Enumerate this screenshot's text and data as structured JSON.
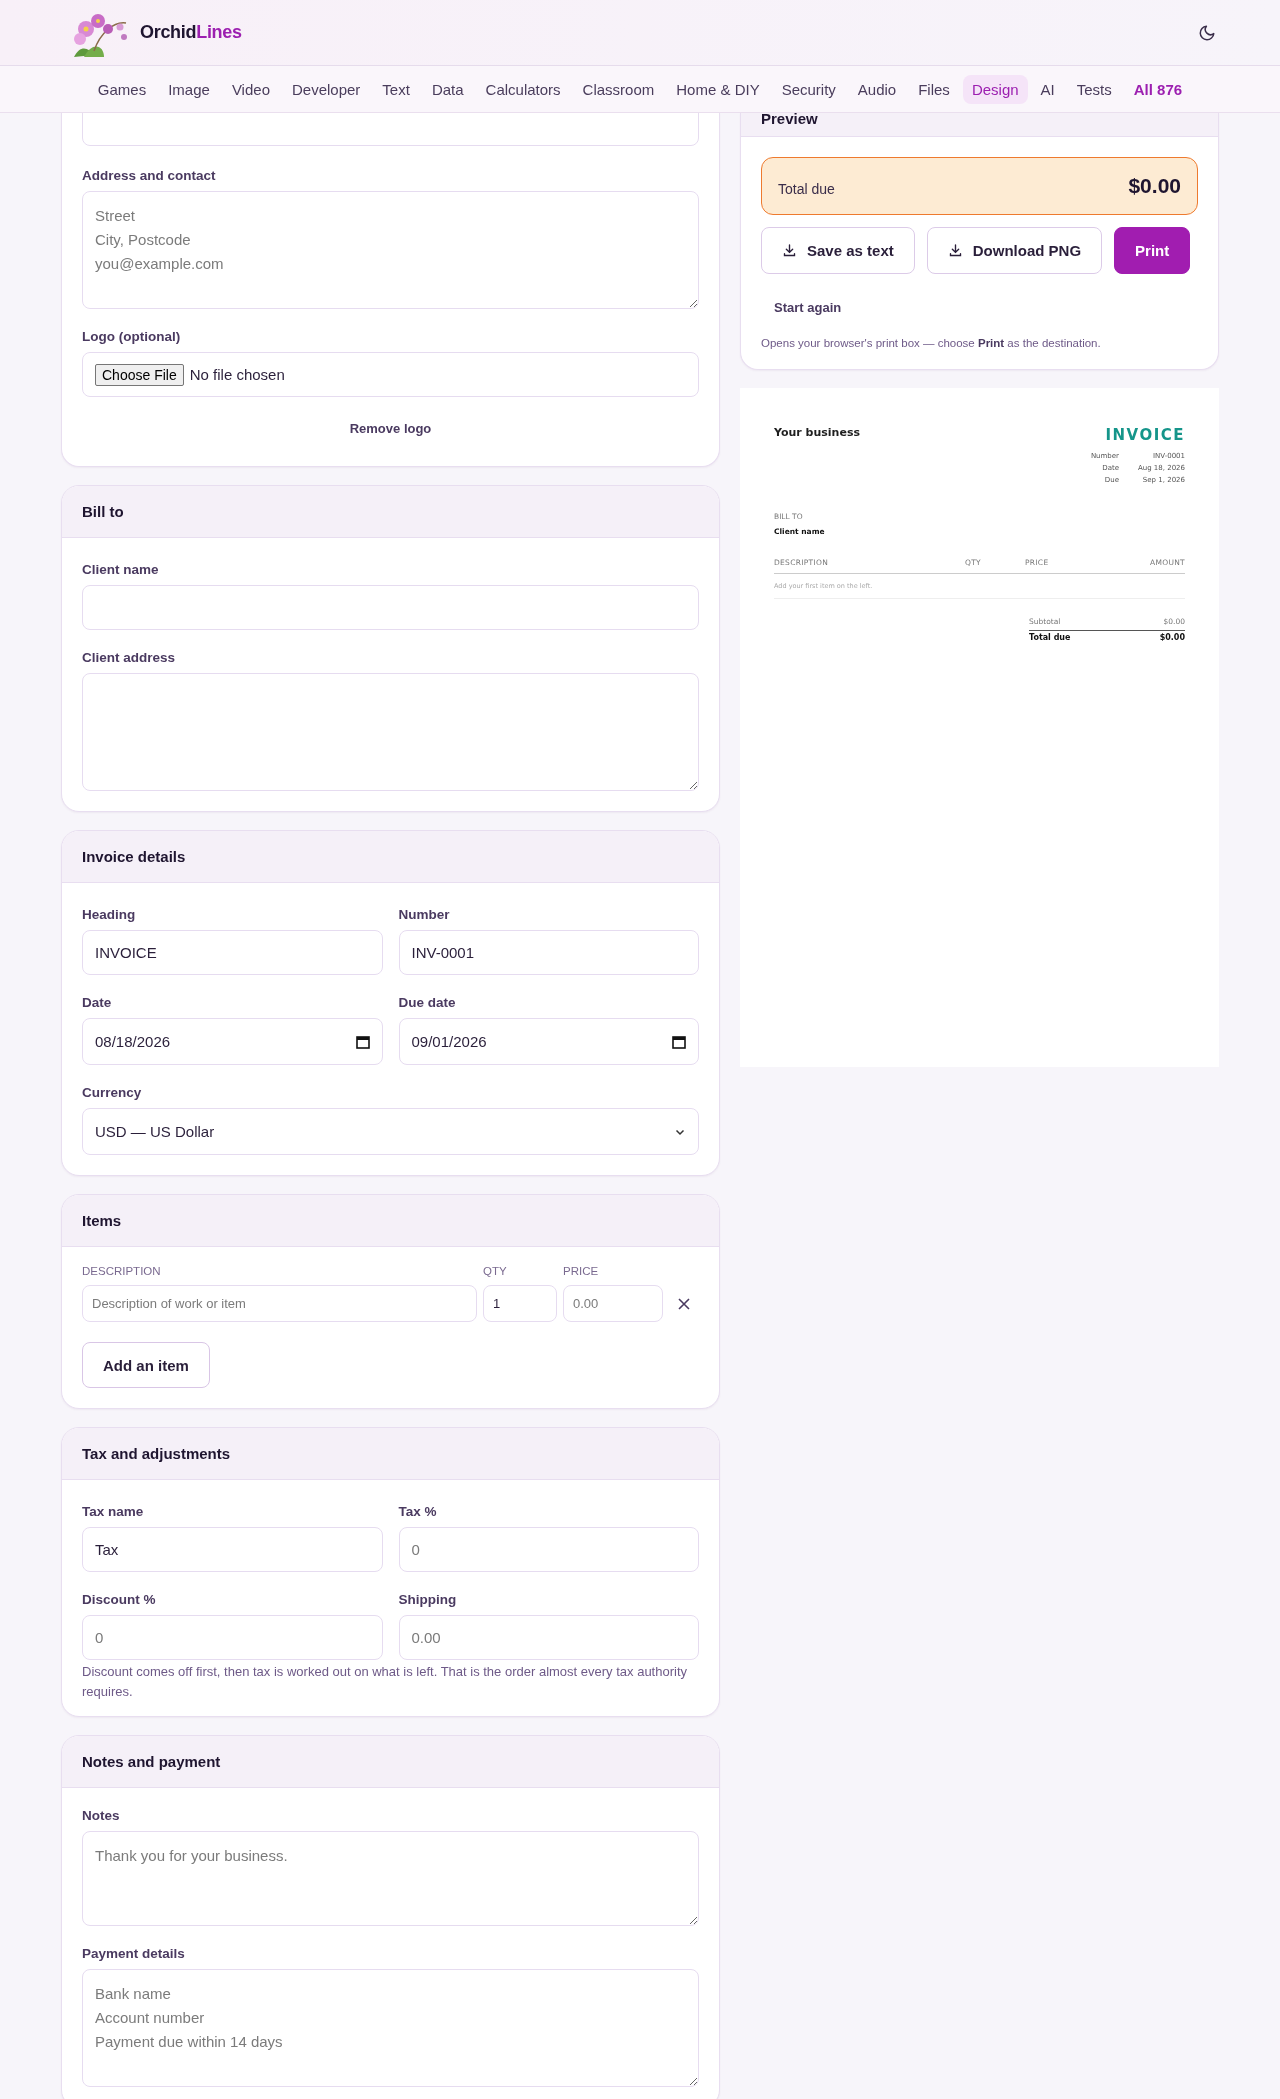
{
  "brand": {
    "part_1": "Orchid",
    "part_2": "Lines"
  },
  "nav": [
    {
      "label": "Games",
      "selected": false
    },
    {
      "label": "Image",
      "selected": false
    },
    {
      "label": "Video",
      "selected": false
    },
    {
      "label": "Developer",
      "selected": false
    },
    {
      "label": "Text",
      "selected": false
    },
    {
      "label": "Data",
      "selected": false
    },
    {
      "label": "Calculators",
      "selected": false
    },
    {
      "label": "Classroom",
      "selected": false
    },
    {
      "label": "Home & DIY",
      "selected": false
    },
    {
      "label": "Security",
      "selected": false
    },
    {
      "label": "Audio",
      "selected": false
    },
    {
      "label": "Files",
      "selected": false
    },
    {
      "label": "Design",
      "selected": true
    },
    {
      "label": "AI",
      "selected": false
    },
    {
      "label": "Tests",
      "selected": false
    }
  ],
  "nav_all": "All 876",
  "business": {
    "address_label": "Address and contact",
    "address_placeholder": "Street\nCity, Postcode\nyou@example.com",
    "logo_label": "Logo (optional)",
    "file_button": "Choose File",
    "file_status": "No file chosen",
    "remove_logo": "Remove logo"
  },
  "bill_to": {
    "title": "Bill to",
    "fields": [
      {
        "kind": "input",
        "label": "Client name"
      },
      {
        "kind": "textarea",
        "label": "Client address"
      }
    ]
  },
  "invoice_details": {
    "title": "Invoice details",
    "fields": [
      {
        "kind": "input",
        "label": "Heading",
        "value": "INVOICE"
      },
      {
        "kind": "input",
        "label": "Number",
        "value": "INV-0001"
      },
      {
        "kind": "date",
        "label": "Date",
        "value": "08/18/2026"
      },
      {
        "kind": "date",
        "label": "Due date",
        "value": "09/01/2026"
      },
      {
        "kind": "select",
        "label": "Currency",
        "value": "USD — US Dollar"
      }
    ]
  },
  "items": {
    "title": "Items",
    "columns": [
      "DESCRIPTION",
      "QTY",
      "PRICE"
    ],
    "rows": [
      {
        "description_placeholder": "Description of work or item",
        "qty": "1",
        "price_placeholder": "0.00"
      }
    ],
    "add_button": "Add an item"
  },
  "tax": {
    "title": "Tax and adjustments",
    "fields": [
      {
        "label": "Tax name",
        "value": "Tax"
      },
      {
        "label": "Tax %",
        "placeholder": "0"
      },
      {
        "label": "Discount %",
        "placeholder": "0"
      },
      {
        "label": "Shipping",
        "placeholder": "0.00"
      }
    ],
    "note": "Discount comes off first, then tax is worked out on what is left. That is the order almost every tax authority requires."
  },
  "notes": {
    "title": "Notes and payment",
    "fields": [
      {
        "label": "Notes",
        "placeholder": "Thank you for your business."
      },
      {
        "label": "Payment details",
        "placeholder": "Bank name\nAccount number\nPayment due within 14 days"
      }
    ]
  },
  "preview": {
    "title": "Preview",
    "total_label": "Total due",
    "total_value": "$0.00",
    "buttons": [
      {
        "label": "Save as text",
        "kind": "download"
      },
      {
        "label": "Download PNG",
        "kind": "download"
      },
      {
        "label": "Print",
        "kind": "primary"
      }
    ],
    "start_again": "Start again",
    "hint": "Opens your browser's print box — choose **Print** as the destination."
  },
  "sheet": {
    "business": "Your business",
    "heading": "INVOICE",
    "meta": [
      {
        "label": "Number",
        "value": "INV-0001"
      },
      {
        "label": "Date",
        "value": "Aug 18, 2026"
      },
      {
        "label": "Due",
        "value": "Sep 1, 2026"
      }
    ],
    "bill_to_label": "BILL TO",
    "client": "Client name",
    "columns": [
      "DESCRIPTION",
      "QTY",
      "PRICE",
      "AMOUNT"
    ],
    "empty": "Add your first item on the left.",
    "subtotal_label": "Subtotal",
    "subtotal_value": "$0.00",
    "total_label": "Total due",
    "total_value": "$0.00"
  }
}
